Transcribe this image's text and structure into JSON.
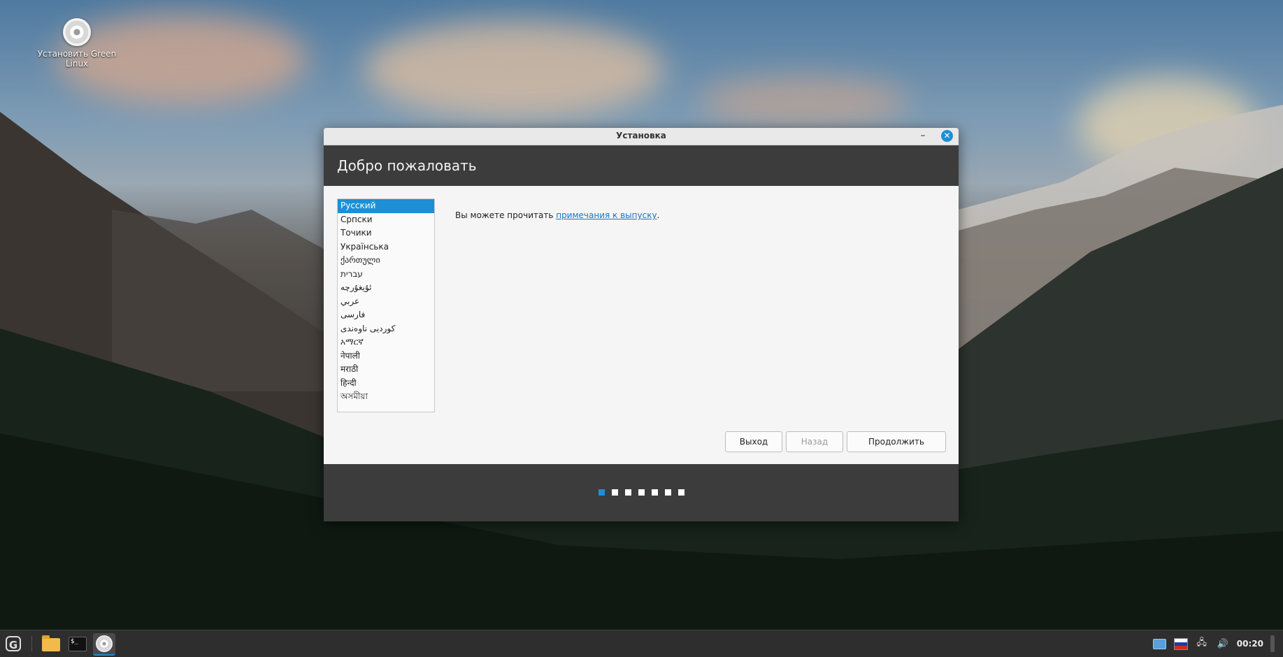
{
  "desktop": {
    "icon_label": "Установить Green Linux"
  },
  "window": {
    "title": "Установка",
    "minimize_glyph": "–",
    "close_glyph": "✕",
    "header": "Добро пожаловать",
    "languages": [
      "Русский",
      "Српски",
      "Точики",
      "Українська",
      "ქართული",
      "עברית",
      "ئۇيغۇرچە",
      "عربي",
      "فارسی",
      "كوردیی ناوەندی",
      "አማርኛ",
      "नेपाली",
      "मराठी",
      "हिन्दी",
      "অসমীয়া"
    ],
    "selected_language_index": 0,
    "release_text_prefix": "Вы можете прочитать ",
    "release_link": "примечания к выпуску",
    "release_text_suffix": ".",
    "buttons": {
      "exit": "Выход",
      "back": "Назад",
      "continue": "Продолжить"
    },
    "steps_total": 7,
    "step_current": 1
  },
  "taskbar": {
    "start_glyph": "G",
    "terminal_glyph": "$_",
    "clock": "00:20",
    "volume_glyph": "🔊",
    "network_glyph": "🖧"
  },
  "colors": {
    "accent": "#1d8fd6",
    "header_bg": "#3c3c3c",
    "flag_ru": [
      "#ffffff",
      "#1c3ea8",
      "#d52b1e"
    ]
  }
}
